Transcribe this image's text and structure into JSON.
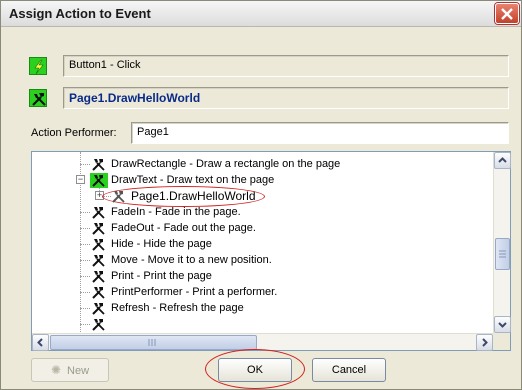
{
  "window": {
    "title": "Assign Action to Event"
  },
  "event": {
    "text": "Button1 - Click",
    "icon": "lightning-icon"
  },
  "action": {
    "text": "Page1.DrawHelloWorld",
    "icon": "tools-icon"
  },
  "performer": {
    "label": "Action Performer:",
    "value": "Page1"
  },
  "tree": {
    "items": [
      {
        "text": "DrawRectangle - Draw a rectangle on the page",
        "icon": "tools-icon"
      },
      {
        "text": "DrawText - Draw text on the page",
        "icon": "tools-icon",
        "expanded": true
      },
      {
        "text": "Page1.DrawHelloWorld",
        "icon": "tools-icon",
        "selected": true
      },
      {
        "text": "FadeIn - Fade in the page.",
        "icon": "tools-icon"
      },
      {
        "text": "FadeOut - Fade out the page.",
        "icon": "tools-icon"
      },
      {
        "text": "Hide - Hide the page",
        "icon": "tools-icon"
      },
      {
        "text": "Move - Move it to a new position.",
        "icon": "tools-icon"
      },
      {
        "text": "Print - Print the page",
        "icon": "tools-icon"
      },
      {
        "text": "PrintPerformer - Print a performer.",
        "icon": "tools-icon"
      },
      {
        "text": "Refresh - Refresh the page",
        "icon": "tools-icon"
      }
    ]
  },
  "buttons": {
    "new": "New",
    "ok": "OK",
    "cancel": "Cancel"
  },
  "colors": {
    "accent": "#2ad21f",
    "highlight": "#d42020",
    "action_text": "#0a2a8a"
  }
}
